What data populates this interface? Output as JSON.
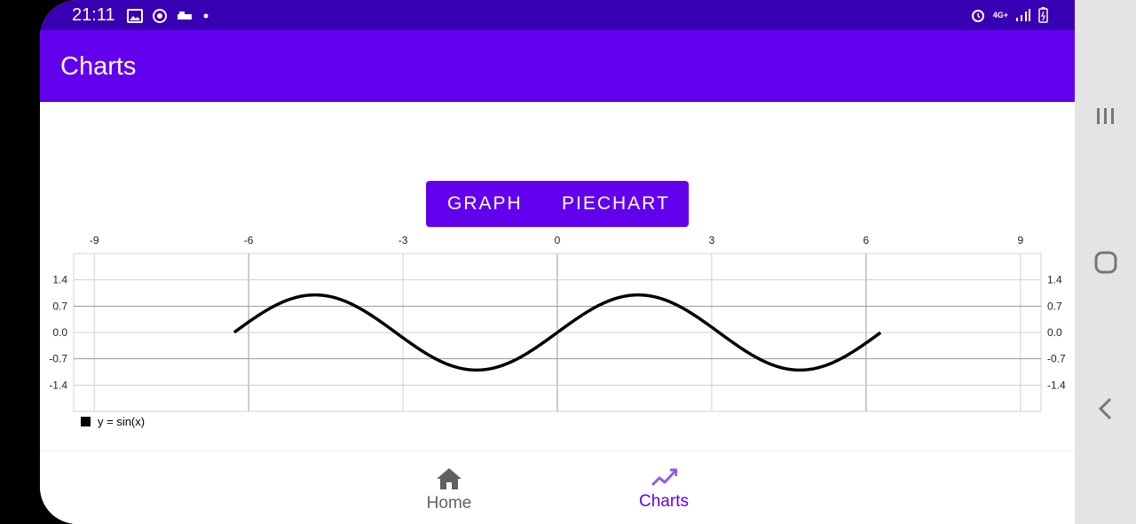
{
  "status": {
    "time": "21:11",
    "network": "4G+"
  },
  "app": {
    "title": "Charts"
  },
  "toggle": {
    "graph_label": "GRAPH",
    "piechart_label": "PIECHART"
  },
  "chart_data": {
    "type": "line",
    "x_ticks": [
      -9,
      -6,
      -3,
      0,
      3,
      6,
      9
    ],
    "y_ticks": [
      "1.4",
      "0.7",
      "0.0",
      "-0.7",
      "-1.4"
    ],
    "xlim": [
      -9.4,
      9.4
    ],
    "ylim": [
      -2.1,
      2.1
    ],
    "series": [
      {
        "name": "y = sin(x)",
        "function": "sin",
        "x_start": -6.28,
        "x_end": 6.28,
        "color": "#000000"
      }
    ],
    "legend_position": "bottom-left"
  },
  "nav": {
    "home_label": "Home",
    "charts_label": "Charts",
    "active": "Charts",
    "active_color": "#6200ee",
    "inactive_color": "#616161"
  },
  "colors": {
    "primary": "#6200ee",
    "primary_dark": "#3700b3"
  }
}
